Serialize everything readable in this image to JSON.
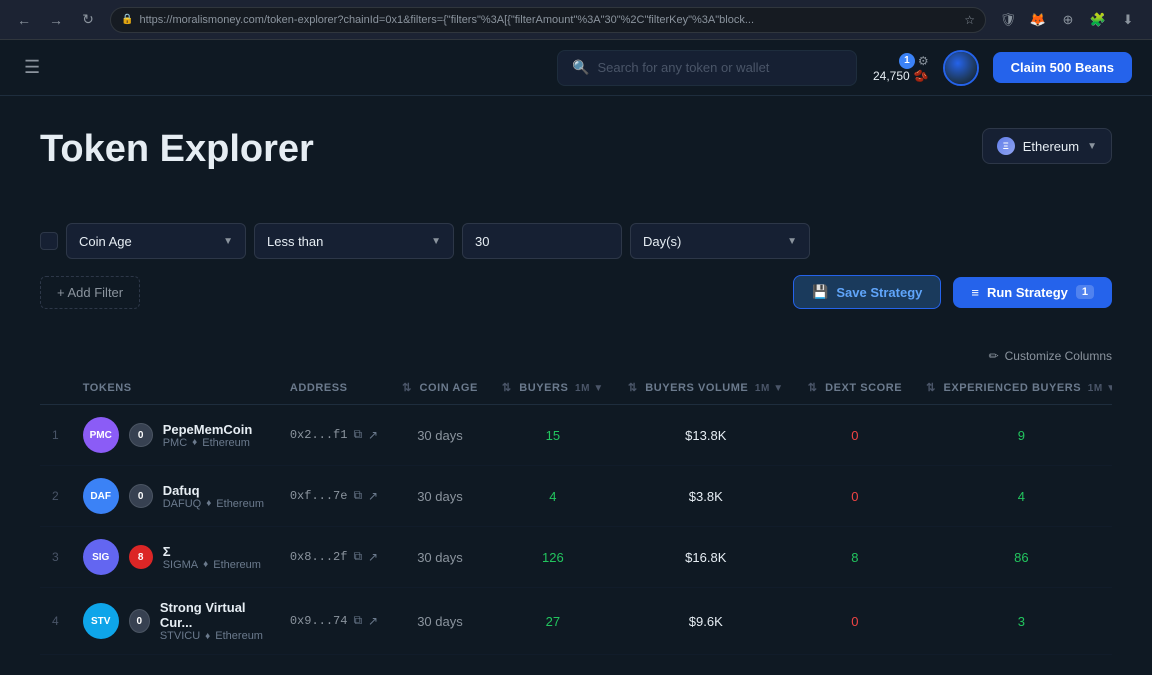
{
  "browser": {
    "url": "https://moralismoney.com/token-explorer?chainId=0x1&filters={\"filters\"%3A[{\"filterAmount\"%3A\"30\"%2C\"filterKey\"%3A\"block..."
  },
  "nav": {
    "search_placeholder": "Search for any token or wallet",
    "beans_count": "24,750",
    "notification_count": "1",
    "claim_button": "Claim 500 Beans"
  },
  "page": {
    "title": "Token Explorer",
    "chain": "Ethereum"
  },
  "filter": {
    "field_label": "Coin Age",
    "condition_label": "Less than",
    "value": "30",
    "unit_label": "Day(s)"
  },
  "buttons": {
    "add_filter": "+ Add Filter",
    "save_strategy": "Save Strategy",
    "run_strategy": "Run Strategy",
    "run_count": "1",
    "customize_columns": "Customize Columns"
  },
  "table": {
    "columns": [
      {
        "key": "tokens",
        "label": "TOKENS",
        "sortable": false
      },
      {
        "key": "address",
        "label": "ADDRESS",
        "sortable": false
      },
      {
        "key": "coin_age",
        "label": "COIN AGE",
        "sortable": true
      },
      {
        "key": "buyers",
        "label": "BUYERS",
        "period": "1M",
        "sortable": true
      },
      {
        "key": "buyers_volume",
        "label": "BUYERS VOLUME",
        "period": "1M",
        "sortable": true
      },
      {
        "key": "dext_score",
        "label": "DEXT SCORE",
        "sortable": true
      },
      {
        "key": "exp_buyers",
        "label": "EXPERIENCED BUYERS",
        "period": "1M",
        "sortable": true
      }
    ],
    "rows": [
      {
        "num": 1,
        "symbol": "PMC",
        "name": "PepeMemCoin",
        "ticker": "PMC",
        "chain": "Ethereum",
        "logo_color": "#8b5cf6",
        "address": "0x2...f1",
        "security": "0",
        "security_type": "safe",
        "coin_age": "30 days",
        "buyers": "15",
        "buyers_volume": "$13.8K",
        "dext_score": "0",
        "dext_type": "red",
        "exp_buyers": "9"
      },
      {
        "num": 2,
        "symbol": "DAF",
        "name": "Dafuq",
        "ticker": "DAFUQ",
        "chain": "Ethereum",
        "logo_color": "#3b82f6",
        "address": "0xf...7e",
        "security": "0",
        "security_type": "safe",
        "coin_age": "30 days",
        "buyers": "4",
        "buyers_volume": "$3.8K",
        "dext_score": "0",
        "dext_type": "red",
        "exp_buyers": "4"
      },
      {
        "num": 3,
        "symbol": "SIG",
        "name": "Σ",
        "ticker": "SIGMA",
        "chain": "Ethereum",
        "logo_color": "#6366f1",
        "address": "0x8...2f",
        "security": "8",
        "security_type": "warn",
        "coin_age": "30 days",
        "buyers": "126",
        "buyers_volume": "$16.8K",
        "dext_score": "8",
        "dext_type": "green",
        "exp_buyers": "86"
      },
      {
        "num": 4,
        "symbol": "STV",
        "name": "Strong Virtual Cur...",
        "ticker": "STVICU",
        "chain": "Ethereum",
        "logo_color": "#0ea5e9",
        "address": "0x9...74",
        "security": "0",
        "security_type": "safe",
        "coin_age": "30 days",
        "buyers": "27",
        "buyers_volume": "$9.6K",
        "dext_score": "0",
        "dext_type": "red",
        "exp_buyers": "3"
      }
    ]
  }
}
